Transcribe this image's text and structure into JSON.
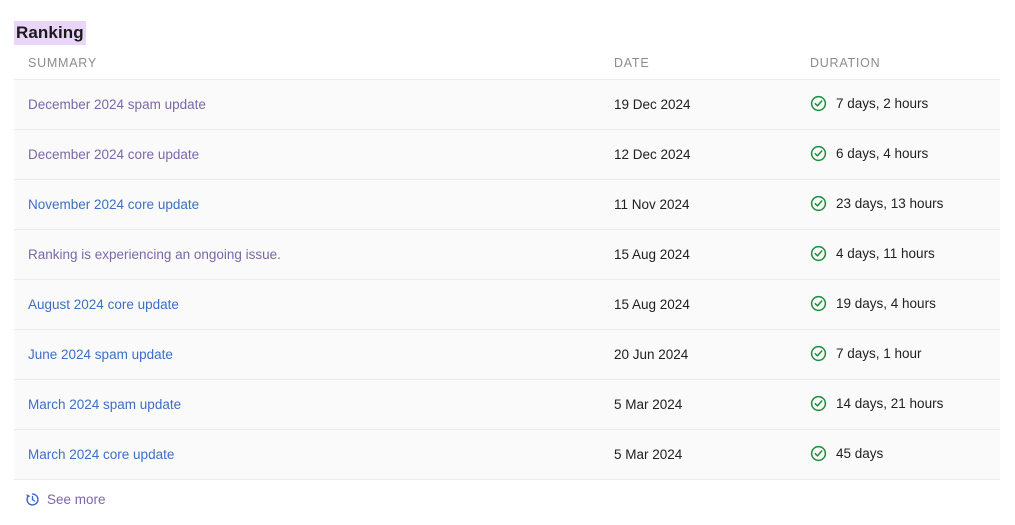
{
  "page": {
    "title": "Ranking",
    "title_highlight_color": "#e9d5f7"
  },
  "table": {
    "columns": [
      {
        "key": "summary",
        "label": "SUMMARY"
      },
      {
        "key": "date",
        "label": "DATE"
      },
      {
        "key": "duration",
        "label": "DURATION"
      }
    ],
    "status_icon": "check-circle-icon",
    "status_icon_color": "#1e8e3e",
    "link_color": "#3b6fc9",
    "visited_link_color": "#7a68ab",
    "rows": [
      {
        "summary": "December 2024 spam update",
        "date": "19 Dec 2024",
        "duration": "7 days, 2 hours",
        "visited": true
      },
      {
        "summary": "December 2024 core update",
        "date": "12 Dec 2024",
        "duration": "6 days, 4 hours",
        "visited": true
      },
      {
        "summary": "November 2024 core update",
        "date": "11 Nov 2024",
        "duration": "23 days, 13 hours",
        "visited": false
      },
      {
        "summary": "Ranking is experiencing an ongoing issue.",
        "date": "15 Aug 2024",
        "duration": "4 days, 11 hours",
        "visited": true
      },
      {
        "summary": "August 2024 core update",
        "date": "15 Aug 2024",
        "duration": "19 days, 4 hours",
        "visited": false
      },
      {
        "summary": "June 2024 spam update",
        "date": "20 Jun 2024",
        "duration": "7 days, 1 hour",
        "visited": false
      },
      {
        "summary": "March 2024 spam update",
        "date": "5 Mar 2024",
        "duration": "14 days, 21 hours",
        "visited": false
      },
      {
        "summary": "March 2024 core update",
        "date": "5 Mar 2024",
        "duration": "45 days",
        "visited": false
      }
    ]
  },
  "footer": {
    "see_more_label": "See more",
    "see_more_icon": "history-clock-icon",
    "see_more_icon_color": "#3b62d4"
  }
}
